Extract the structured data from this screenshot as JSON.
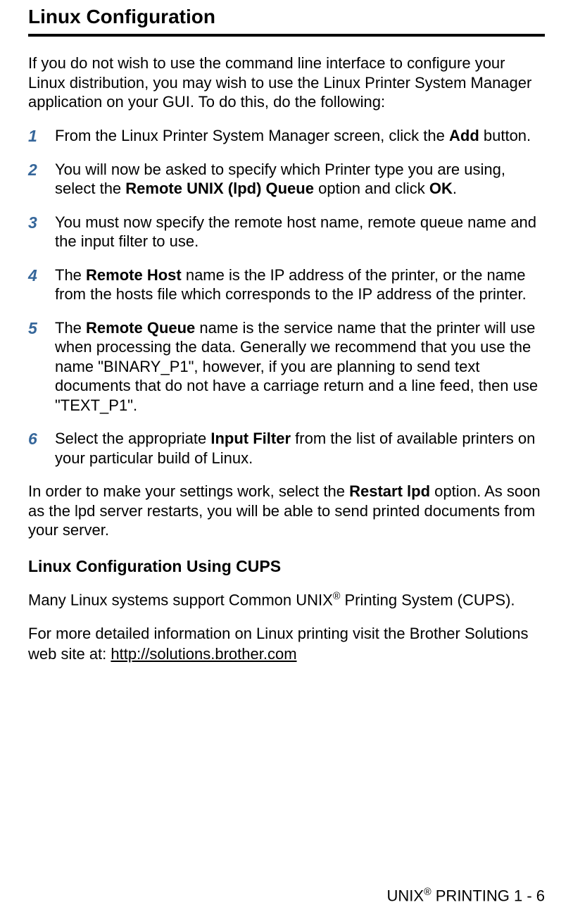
{
  "title": "Linux Configuration",
  "intro": "If you do not wish to use the command line interface to configure your Linux distribution, you may wish to use the Linux Printer System Manager application on your GUI. To do this, do the following:",
  "steps": [
    {
      "num": "1",
      "before": "From the Linux Printer System Manager screen, click the ",
      "bold1": "Add",
      "after1": " button."
    },
    {
      "num": "2",
      "before": "You will now be asked to specify which Printer type you are using, select the ",
      "bold1": "Remote UNIX (lpd) Queue",
      "mid1": " option and click ",
      "bold2": "OK",
      "after2": "."
    },
    {
      "num": "3",
      "before": "You must now specify the remote host name, remote queue name and the input filter to use."
    },
    {
      "num": "4",
      "before": "The ",
      "bold1": "Remote Host",
      "after1": " name is the IP address of the printer, or the name from the hosts file which corresponds to the IP address of the printer."
    },
    {
      "num": "5",
      "before": "The ",
      "bold1": "Remote Queue",
      "after1": " name is the service name that the printer will use when processing the data. Generally we recommend that you use the name \"BINARY_P1\", however, if you are planning to send text documents that do not have a carriage return and a line feed, then use \"TEXT_P1\"."
    },
    {
      "num": "6",
      "before": "Select the appropriate ",
      "bold1": "Input Filter",
      "after1": " from the list of available printers on your particular build of Linux."
    }
  ],
  "closing_before": "In order to make your settings work, select the ",
  "closing_bold": "Restart lpd",
  "closing_after": " option. As soon as the lpd server restarts, you will be able to send printed documents from your server.",
  "sub_heading": "Linux Configuration Using CUPS",
  "sub_para1_before": "Many Linux systems support Common UNIX",
  "sub_para1_reg": "®",
  "sub_para1_after": " Printing System (CUPS).",
  "sub_para2_before": "For more detailed information on Linux printing visit the Brother Solutions web site at: ",
  "sub_para2_link": "http://solutions.brother.com",
  "footer_before": "UNIX",
  "footer_reg": "®",
  "footer_after": " PRINTING 1 - 6"
}
